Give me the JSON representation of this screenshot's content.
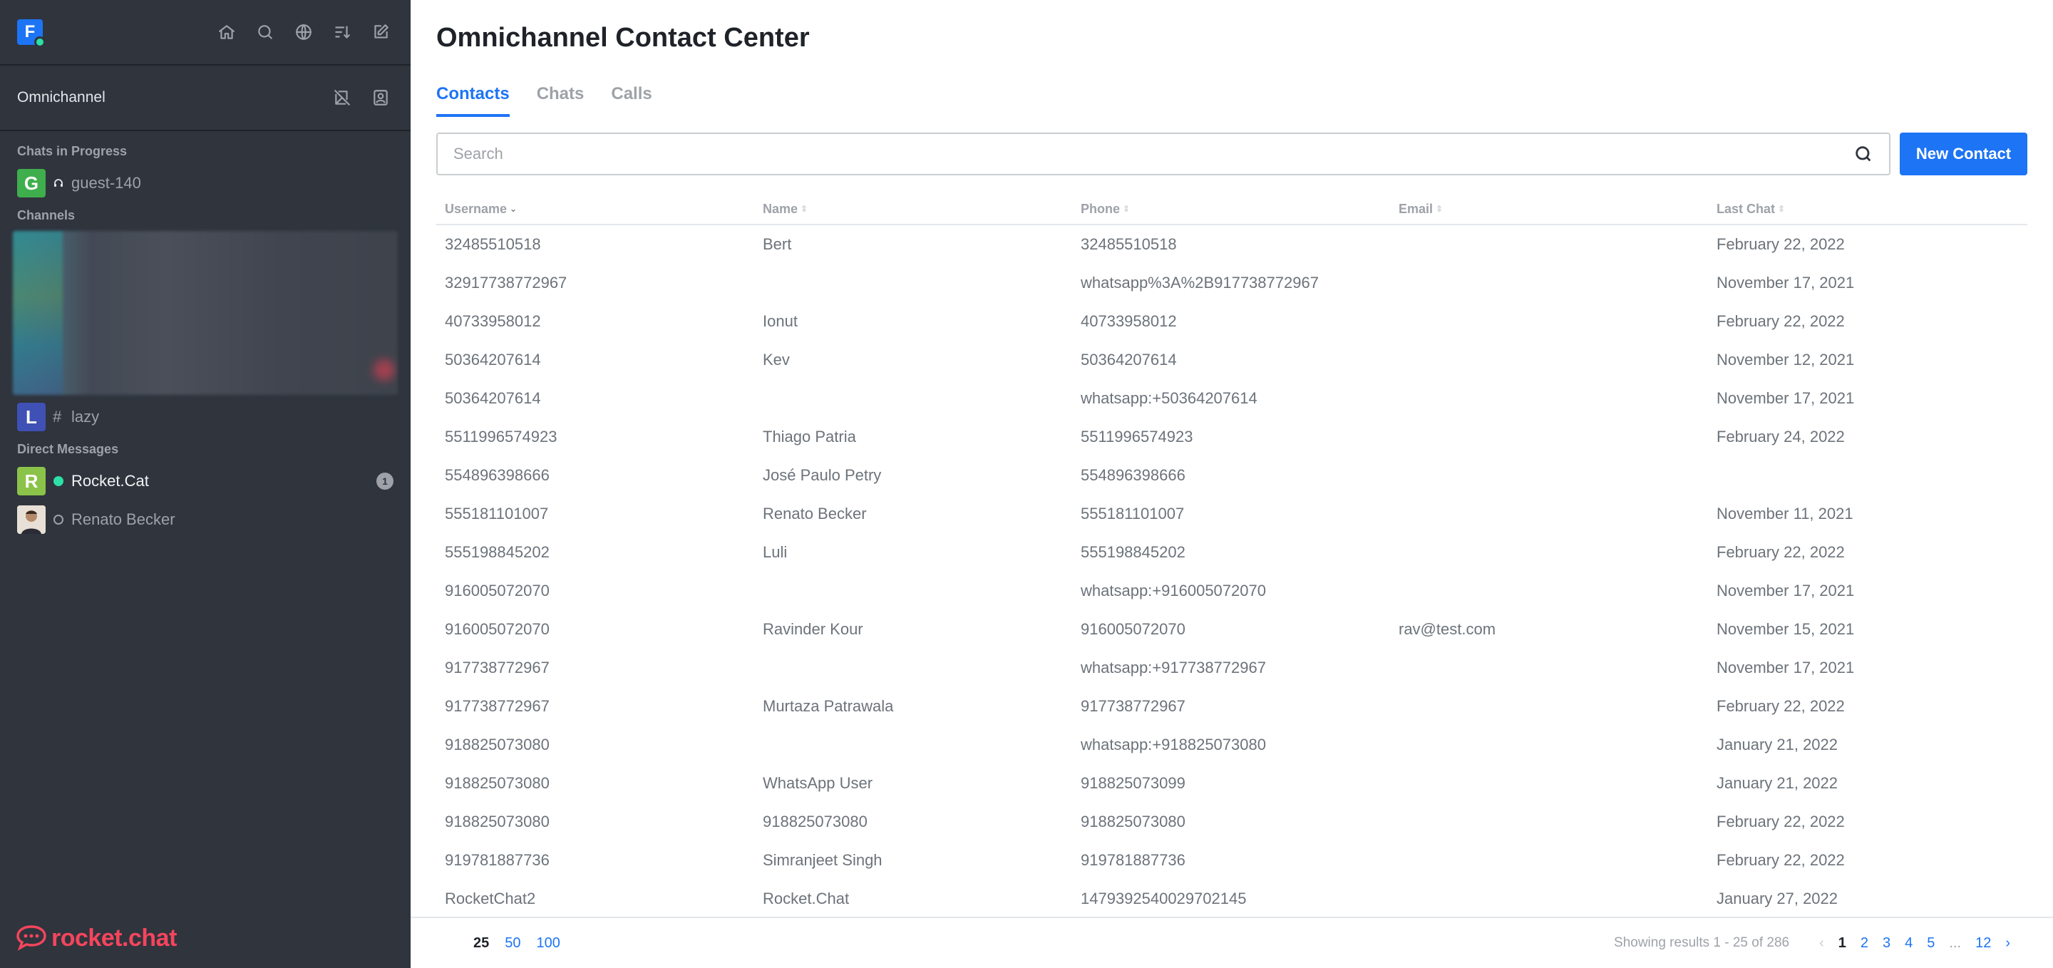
{
  "sidebar": {
    "workspace_initial": "F",
    "section_header": "Omnichannel",
    "sections": {
      "in_progress": "Chats in Progress",
      "channels": "Channels",
      "direct": "Direct Messages"
    },
    "chats_in_progress": [
      {
        "initial": "G",
        "color": "#3fae4c",
        "name": "guest-140"
      }
    ],
    "channels": [
      {
        "initial": "L",
        "color": "#3f51b5",
        "name": "lazy"
      }
    ],
    "direct_messages": [
      {
        "initial": "R",
        "color": "#8bc34a",
        "name": "Rocket.Cat",
        "status": "online",
        "unread": "1"
      },
      {
        "initial": "",
        "color": "#c7a17a",
        "name": "Renato Becker",
        "status": "offline"
      }
    ],
    "brand": "rocket.chat"
  },
  "main": {
    "title": "Omnichannel Contact Center",
    "tabs": [
      "Contacts",
      "Chats",
      "Calls"
    ],
    "search_placeholder": "Search",
    "new_contact_label": "New Contact",
    "columns": [
      "Username",
      "Name",
      "Phone",
      "Email",
      "Last Chat"
    ],
    "rows": [
      [
        "32485510518",
        "Bert",
        "32485510518",
        "",
        "February 22, 2022"
      ],
      [
        "32917738772967",
        "",
        "whatsapp%3A%2B917738772967",
        "",
        "November 17, 2021"
      ],
      [
        "40733958012",
        "Ionut",
        "40733958012",
        "",
        "February 22, 2022"
      ],
      [
        "50364207614",
        "Kev",
        "50364207614",
        "",
        "November 12, 2021"
      ],
      [
        "50364207614",
        "",
        "whatsapp:+50364207614",
        "",
        "November 17, 2021"
      ],
      [
        "5511996574923",
        "Thiago Patria",
        "5511996574923",
        "",
        "February 24, 2022"
      ],
      [
        "554896398666",
        "José Paulo Petry",
        "554896398666",
        "",
        ""
      ],
      [
        "555181101007",
        "Renato Becker",
        "555181101007",
        "",
        "November 11, 2021"
      ],
      [
        "555198845202",
        "Luli",
        "555198845202",
        "",
        "February 22, 2022"
      ],
      [
        "916005072070",
        "",
        "whatsapp:+916005072070",
        "",
        "November 17, 2021"
      ],
      [
        "916005072070",
        "Ravinder Kour",
        "916005072070",
        "rav@test.com",
        "November 15, 2021"
      ],
      [
        "917738772967",
        "",
        "whatsapp:+917738772967",
        "",
        "November 17, 2021"
      ],
      [
        "917738772967",
        "Murtaza Patrawala",
        "917738772967",
        "",
        "February 22, 2022"
      ],
      [
        "918825073080",
        "",
        "whatsapp:+918825073080",
        "",
        "January 21, 2022"
      ],
      [
        "918825073080",
        "WhatsApp User",
        "918825073099",
        "",
        "January 21, 2022"
      ],
      [
        "918825073080",
        "918825073080",
        "918825073080",
        "",
        "February 22, 2022"
      ],
      [
        "919781887736",
        "Simranjeet Singh",
        "919781887736",
        "",
        "February 22, 2022"
      ],
      [
        "RocketChat2",
        "Rocket.Chat",
        "1479392540029702145",
        "",
        "January 27, 2022"
      ]
    ],
    "per_page": [
      "25",
      "50",
      "100"
    ],
    "showing": "Showing results 1 - 25 of 286",
    "pages": [
      "1",
      "2",
      "3",
      "4",
      "5",
      "...",
      "12"
    ]
  },
  "colors": {
    "accent": "#1d74f5",
    "sidebar_bg": "#2f343d",
    "online": "#2de0a5",
    "brand_red": "#f5455c"
  }
}
